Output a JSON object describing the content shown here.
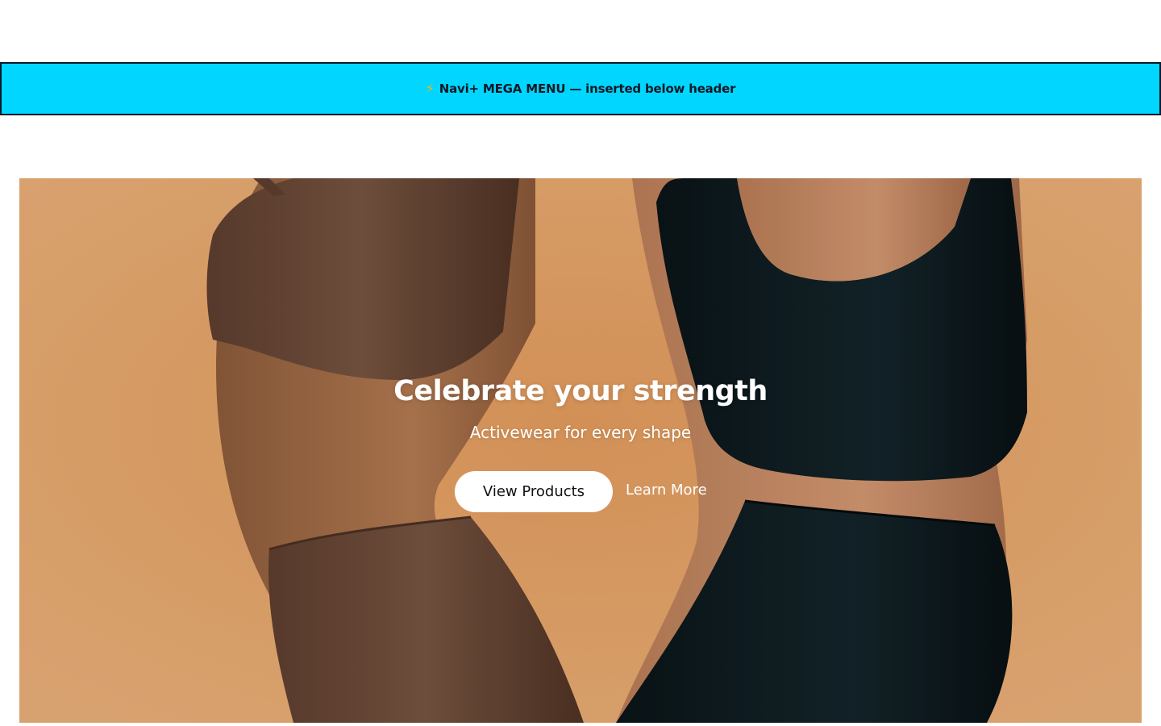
{
  "colors": {
    "banner_bg": "#00d6ff",
    "banner_border": "#0b1a2a",
    "hero_bg": "#e3a46a",
    "top_brown": "#6b4a3a",
    "top_black": "#0d1a1e"
  },
  "banner": {
    "icon": "lightning-bolt-icon",
    "icon_glyph": "⚡",
    "text": "Navi+ MEGA MENU — inserted below header"
  },
  "hero": {
    "title": "Celebrate your strength",
    "subtitle": "Activewear for every shape",
    "primary_button": "View Products",
    "secondary_link": "Learn More"
  }
}
